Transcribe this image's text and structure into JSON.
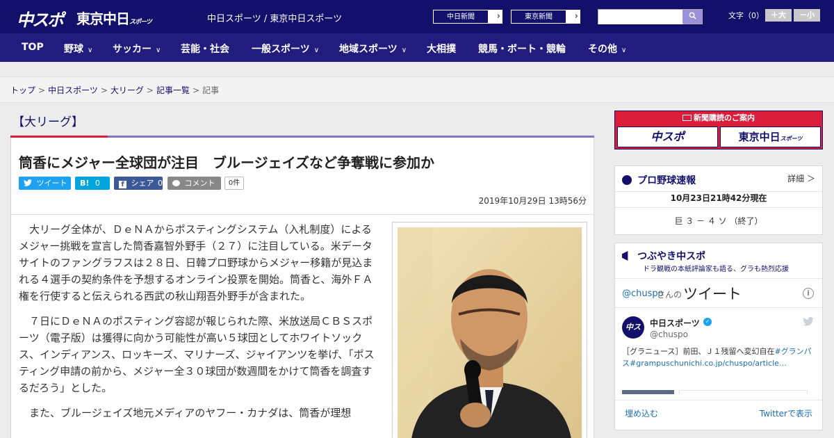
{
  "header": {
    "logo_chuspo": "中スポ",
    "logo_tokyo": "東京中日",
    "logo_tokyo_sub": "スポーツ",
    "site_name": "中日スポーツ / 東京中日スポーツ",
    "links": [
      {
        "label": "中日新聞"
      },
      {
        "label": "東京新聞"
      }
    ],
    "search_placeholder": "",
    "font_size_label": "文字（0）",
    "font_up": "＋大",
    "font_down": "－小"
  },
  "nav": [
    {
      "label": "TOP",
      "has_menu": false
    },
    {
      "label": "野球",
      "has_menu": true
    },
    {
      "label": "サッカー",
      "has_menu": true
    },
    {
      "label": "芸能・社会",
      "has_menu": false
    },
    {
      "label": "一般スポーツ",
      "has_menu": true
    },
    {
      "label": "地域スポーツ",
      "has_menu": true
    },
    {
      "label": "大相撲",
      "has_menu": false
    },
    {
      "label": "競馬・ボート・競輪",
      "has_menu": false
    },
    {
      "label": "その他",
      "has_menu": true
    }
  ],
  "breadcrumb": [
    "トップ",
    "中日スポーツ",
    "大リーグ",
    "記事一覧",
    "記事"
  ],
  "section_title": "【大リーグ】",
  "article": {
    "headline": "筒香にメジャー全球団が注目　ブルージェイズなど争奪戦に参加か",
    "share": {
      "tweet": "ツイート",
      "hatena": "B!",
      "hatena_count": "0",
      "facebook": "シェア",
      "facebook_count": "0",
      "comment": "コメント",
      "comment_count": "0件"
    },
    "date": "2019年10月29日 13時56分",
    "paragraphs": [
      "大リーグ全体が、ＤｅＮＡからポスティングシステム（入札制度）によるメジャー挑戦を宣言した筒香嘉智外野手（２７）に注目している。米データサイトのファングラフスは２８日、日韓プロ野球からメジャー移籍が見込まれる４選手の契約条件を予想するオンライン投票を開始。筒香と、海外ＦＡ権を行使すると伝えられる西武の秋山翔吾外野手が含まれた。",
      "７日にＤｅＮＡのポスティング容認が報じられた際、米放送局ＣＢＳスポーツ（電子版）は獲得に向かう可能性が高い５球団としてホワイトソックス、インディアンス、ロッキーズ、マリナーズ、ジャイアンツを挙げ、「ポスティング申請の前から、メジャー全３０球団が数週間をかけて筒香を調査するだろう」とした。",
      "また、ブルージェイズ地元メディアのヤフー・カナダは、筒香が理想"
    ]
  },
  "sidebar": {
    "subscribe_title": "新聞購読のご案内",
    "subscribe_chuspo": "中スポ",
    "subscribe_tokyo": "東京中日",
    "subscribe_tokyo_sub": "スポーツ",
    "baseball": {
      "title": "プロ野球速報",
      "detail": "詳細 ＞",
      "as_of": "10月23日21時42分現在",
      "score": "巨 ３ － ４ ソ （終了）"
    },
    "tweets": {
      "title": "つぶやき中スポ",
      "subtitle": "ドラ観戦の本紙評論家も語る、グラも熱烈応援",
      "handle_prefix": "@chuspo",
      "handle_suffix": "さんの",
      "tweet_word": "ツイート",
      "account_name": "中日スポーツ",
      "account_handle": "@chuspo",
      "tweet_text": "［グラニュース］前田、Ｊ１残留へ変幻自在",
      "tweet_hashtag": "#グランパス",
      "tweet_link": "#grampuschunichi.co.jp/chuspo/article…",
      "embed": "埋め込む",
      "view_on_twitter": "Twitterで表示"
    }
  },
  "colors": {
    "header": "#12106b",
    "nav": "#211c7e",
    "accent_red": "#d91d3a",
    "twitter": "#1da1f2",
    "hatena": "#00a4de",
    "facebook": "#3b5998"
  }
}
